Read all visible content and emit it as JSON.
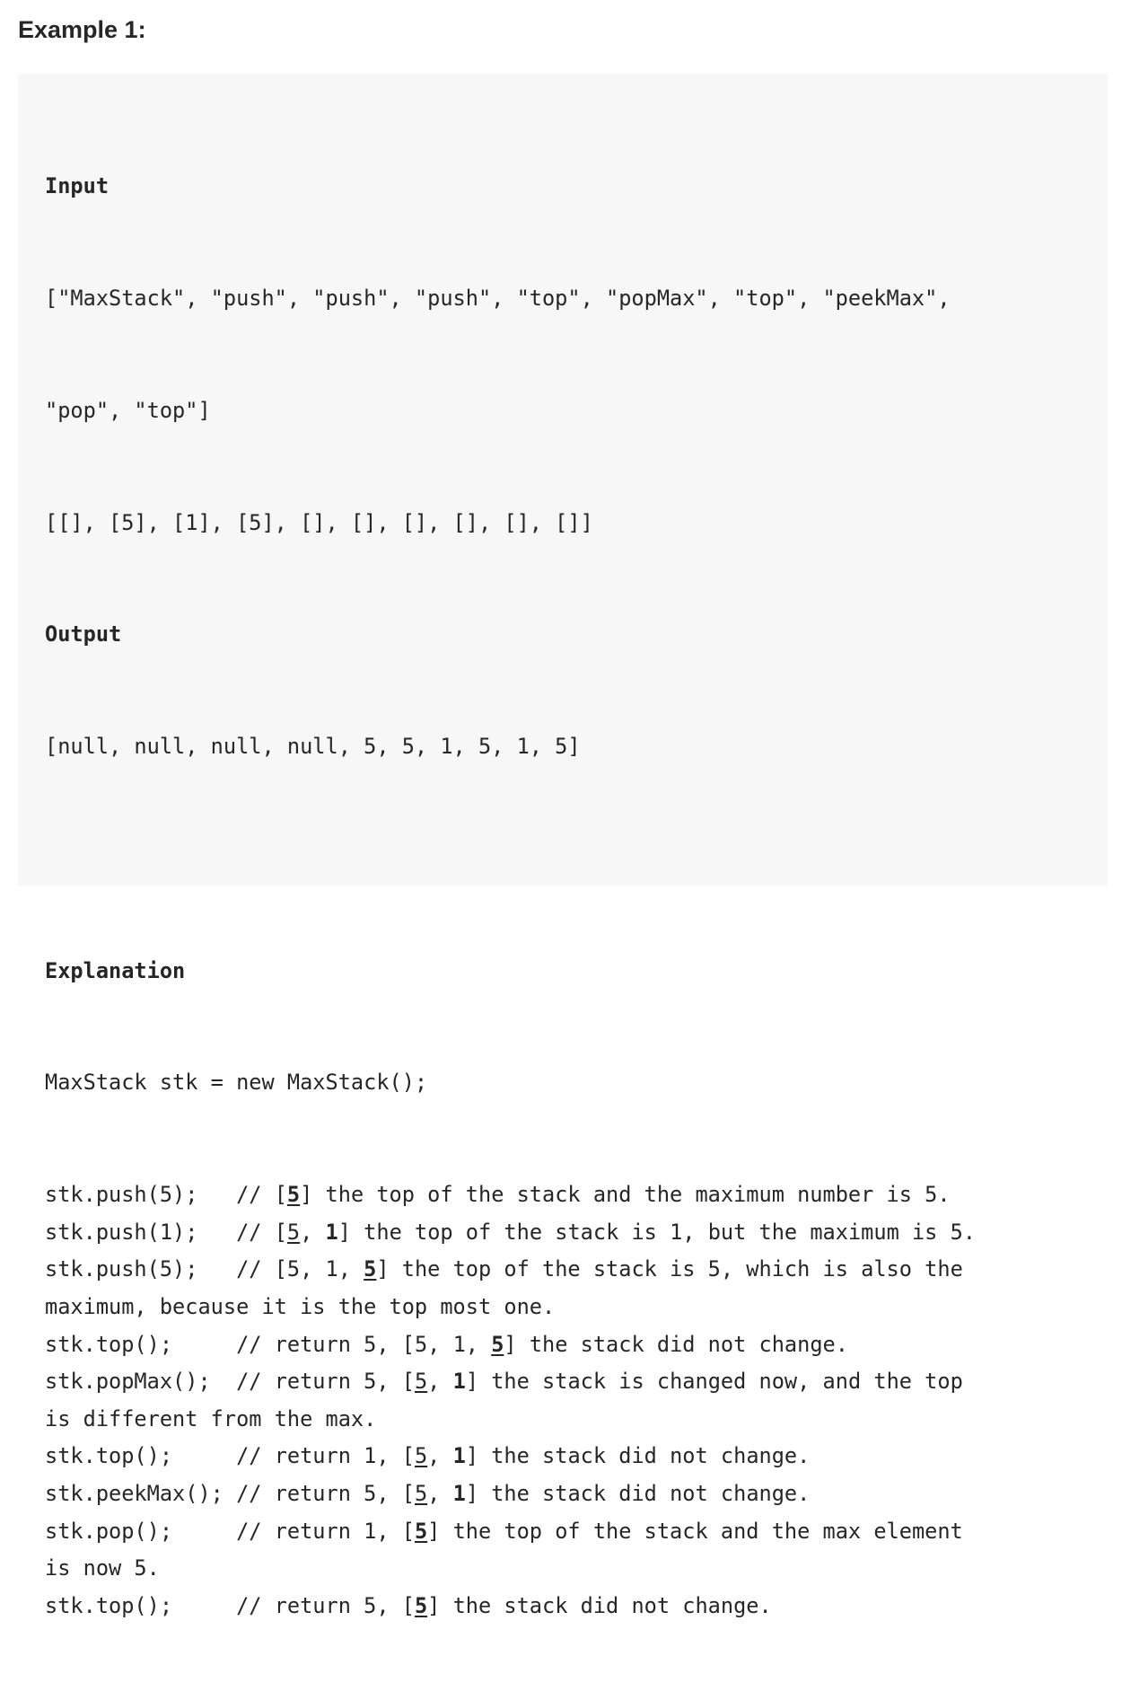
{
  "heading": "Example 1:",
  "input_label": "Input",
  "input_lines": [
    "[\"MaxStack\", \"push\", \"push\", \"push\", \"top\", \"popMax\", \"top\", \"peekMax\",",
    "\"pop\", \"top\"]",
    "[[], [5], [1], [5], [], [], [], [], [], []]"
  ],
  "output_label": "Output",
  "output_line": "[null, null, null, null, 5, 5, 1, 5, 1, 5]",
  "explanation_label": "Explanation",
  "declaration": "MaxStack stk = new MaxStack();",
  "steps": [
    {
      "call": "stk.push(5);   ",
      "comment_pre": "// [",
      "stack": [
        {
          "t": "5",
          "u": true,
          "b": true
        }
      ],
      "comment_post": "] the top of the stack and the maximum number is 5."
    },
    {
      "call": "stk.push(1);   ",
      "comment_pre": "// [",
      "stack": [
        {
          "t": "5",
          "u": true,
          "b": false
        },
        {
          "t": ", ",
          "u": false,
          "b": false
        },
        {
          "t": "1",
          "u": false,
          "b": true
        }
      ],
      "comment_post": "] the top of the stack is 1, but the maximum is 5."
    },
    {
      "call": "stk.push(5);   ",
      "comment_pre": "// [",
      "stack": [
        {
          "t": "5, 1, ",
          "u": false,
          "b": false
        },
        {
          "t": "5",
          "u": true,
          "b": true
        }
      ],
      "comment_post": "] the top of the stack is 5, which is also the",
      "continuation": "maximum, because it is the top most one."
    },
    {
      "call": "stk.top();     ",
      "comment_pre": "// return 5, [",
      "stack": [
        {
          "t": "5, 1, ",
          "u": false,
          "b": false
        },
        {
          "t": "5",
          "u": true,
          "b": true
        }
      ],
      "comment_post": "] the stack did not change."
    },
    {
      "call": "stk.popMax();  ",
      "comment_pre": "// return 5, [",
      "stack": [
        {
          "t": "5",
          "u": true,
          "b": false
        },
        {
          "t": ", ",
          "u": false,
          "b": false
        },
        {
          "t": "1",
          "u": false,
          "b": true
        }
      ],
      "comment_post": "] the stack is changed now, and the top",
      "continuation": "is different from the max."
    },
    {
      "call": "stk.top();     ",
      "comment_pre": "// return 1, [",
      "stack": [
        {
          "t": "5",
          "u": true,
          "b": false
        },
        {
          "t": ", ",
          "u": false,
          "b": false
        },
        {
          "t": "1",
          "u": false,
          "b": true
        }
      ],
      "comment_post": "] the stack did not change."
    },
    {
      "call": "stk.peekMax(); ",
      "comment_pre": "// return 5, [",
      "stack": [
        {
          "t": "5",
          "u": true,
          "b": false
        },
        {
          "t": ", ",
          "u": false,
          "b": false
        },
        {
          "t": "1",
          "u": false,
          "b": true
        }
      ],
      "comment_post": "] the stack did not change."
    },
    {
      "call": "stk.pop();     ",
      "comment_pre": "// return 1, [",
      "stack": [
        {
          "t": "5",
          "u": true,
          "b": true
        }
      ],
      "comment_post": "] the top of the stack and the max element",
      "continuation": "is now 5."
    },
    {
      "call": "stk.top();     ",
      "comment_pre": "// return 5, [",
      "stack": [
        {
          "t": "5",
          "u": true,
          "b": true
        }
      ],
      "comment_post": "] the stack did not change."
    }
  ]
}
